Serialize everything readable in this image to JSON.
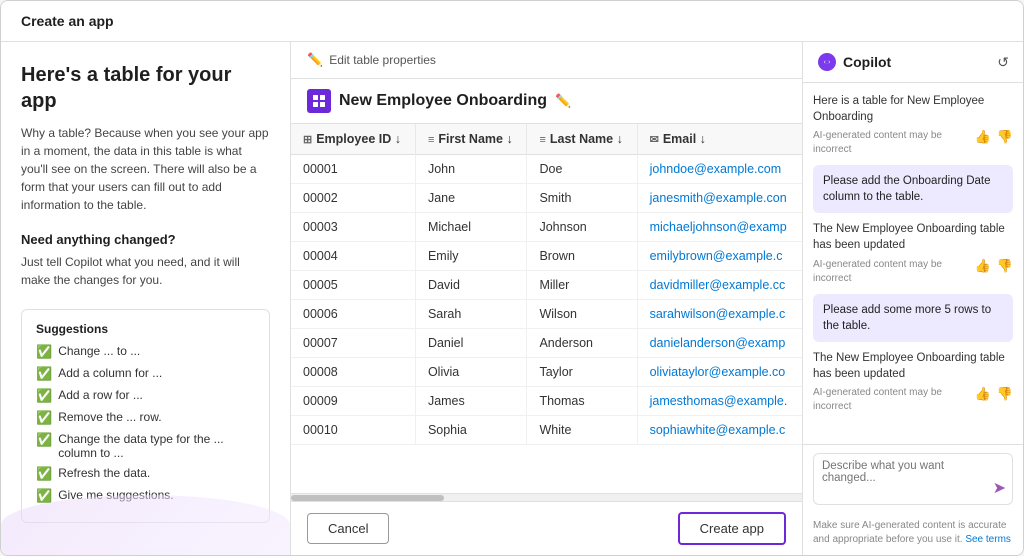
{
  "topBar": {
    "title": "Create an app"
  },
  "leftPanel": {
    "heading": "Here's a table for your app",
    "description": "Why a table? Because when you see your app in a moment, the data in this table is what you'll see on the screen. There will also be a form that your users can fill out to add information to the table.",
    "needChangedLabel": "Need anything changed?",
    "needChangedDesc": "Just tell Copilot what you need, and it will make the changes for you.",
    "suggestions": {
      "title": "Suggestions",
      "items": [
        "Change ... to ...",
        "Add a column for ...",
        "Add a row for ...",
        "Remove the ... row.",
        "Change the data type for the ... column to ...",
        "Refresh the data.",
        "Give me suggestions."
      ]
    }
  },
  "middlePanel": {
    "editTableLabel": "Edit table properties",
    "tableName": "New Employee Onboarding",
    "columns": [
      {
        "icon": "grid-icon",
        "label": "Employee ID ↓"
      },
      {
        "icon": "text-icon",
        "label": "First Name ↓"
      },
      {
        "icon": "text-icon",
        "label": "Last Name ↓"
      },
      {
        "icon": "email-icon",
        "label": "Email ↓"
      }
    ],
    "rows": [
      {
        "id": "00001",
        "firstName": "John",
        "lastName": "Doe",
        "email": "johndoe@example.com"
      },
      {
        "id": "00002",
        "firstName": "Jane",
        "lastName": "Smith",
        "email": "janesmith@example.con"
      },
      {
        "id": "00003",
        "firstName": "Michael",
        "lastName": "Johnson",
        "email": "michaeljohnson@examp"
      },
      {
        "id": "00004",
        "firstName": "Emily",
        "lastName": "Brown",
        "email": "emilybrown@example.c"
      },
      {
        "id": "00005",
        "firstName": "David",
        "lastName": "Miller",
        "email": "davidmiller@example.cc"
      },
      {
        "id": "00006",
        "firstName": "Sarah",
        "lastName": "Wilson",
        "email": "sarahwilson@example.c"
      },
      {
        "id": "00007",
        "firstName": "Daniel",
        "lastName": "Anderson",
        "email": "danielanderson@examp"
      },
      {
        "id": "00008",
        "firstName": "Olivia",
        "lastName": "Taylor",
        "email": "oliviataylor@example.co"
      },
      {
        "id": "00009",
        "firstName": "James",
        "lastName": "Thomas",
        "email": "jamesthomas@example."
      },
      {
        "id": "00010",
        "firstName": "Sophia",
        "lastName": "White",
        "email": "sophiawhite@example.c"
      }
    ],
    "cancelButton": "Cancel",
    "createAppButton": "Create app"
  },
  "rightPanel": {
    "title": "Copilot",
    "messages": [
      {
        "type": "ai",
        "text": "Here is a table for New Employee Onboarding",
        "note": "AI-generated content may be incorrect"
      },
      {
        "type": "user",
        "text": "Please add the Onboarding Date column to the table."
      },
      {
        "type": "ai",
        "text": "The New Employee Onboarding table has been updated",
        "note": "AI-generated content may be incorrect"
      },
      {
        "type": "user",
        "text": "Please add some more 5 rows to the table."
      },
      {
        "type": "ai",
        "text": "The New Employee Onboarding table has been updated",
        "note": "AI-generated content may be incorrect"
      }
    ],
    "inputPlaceholder": "Describe what you want changed...",
    "footerText": "Make sure AI-generated content is accurate and appropriate before you use it.",
    "footerLink": "See terms"
  }
}
